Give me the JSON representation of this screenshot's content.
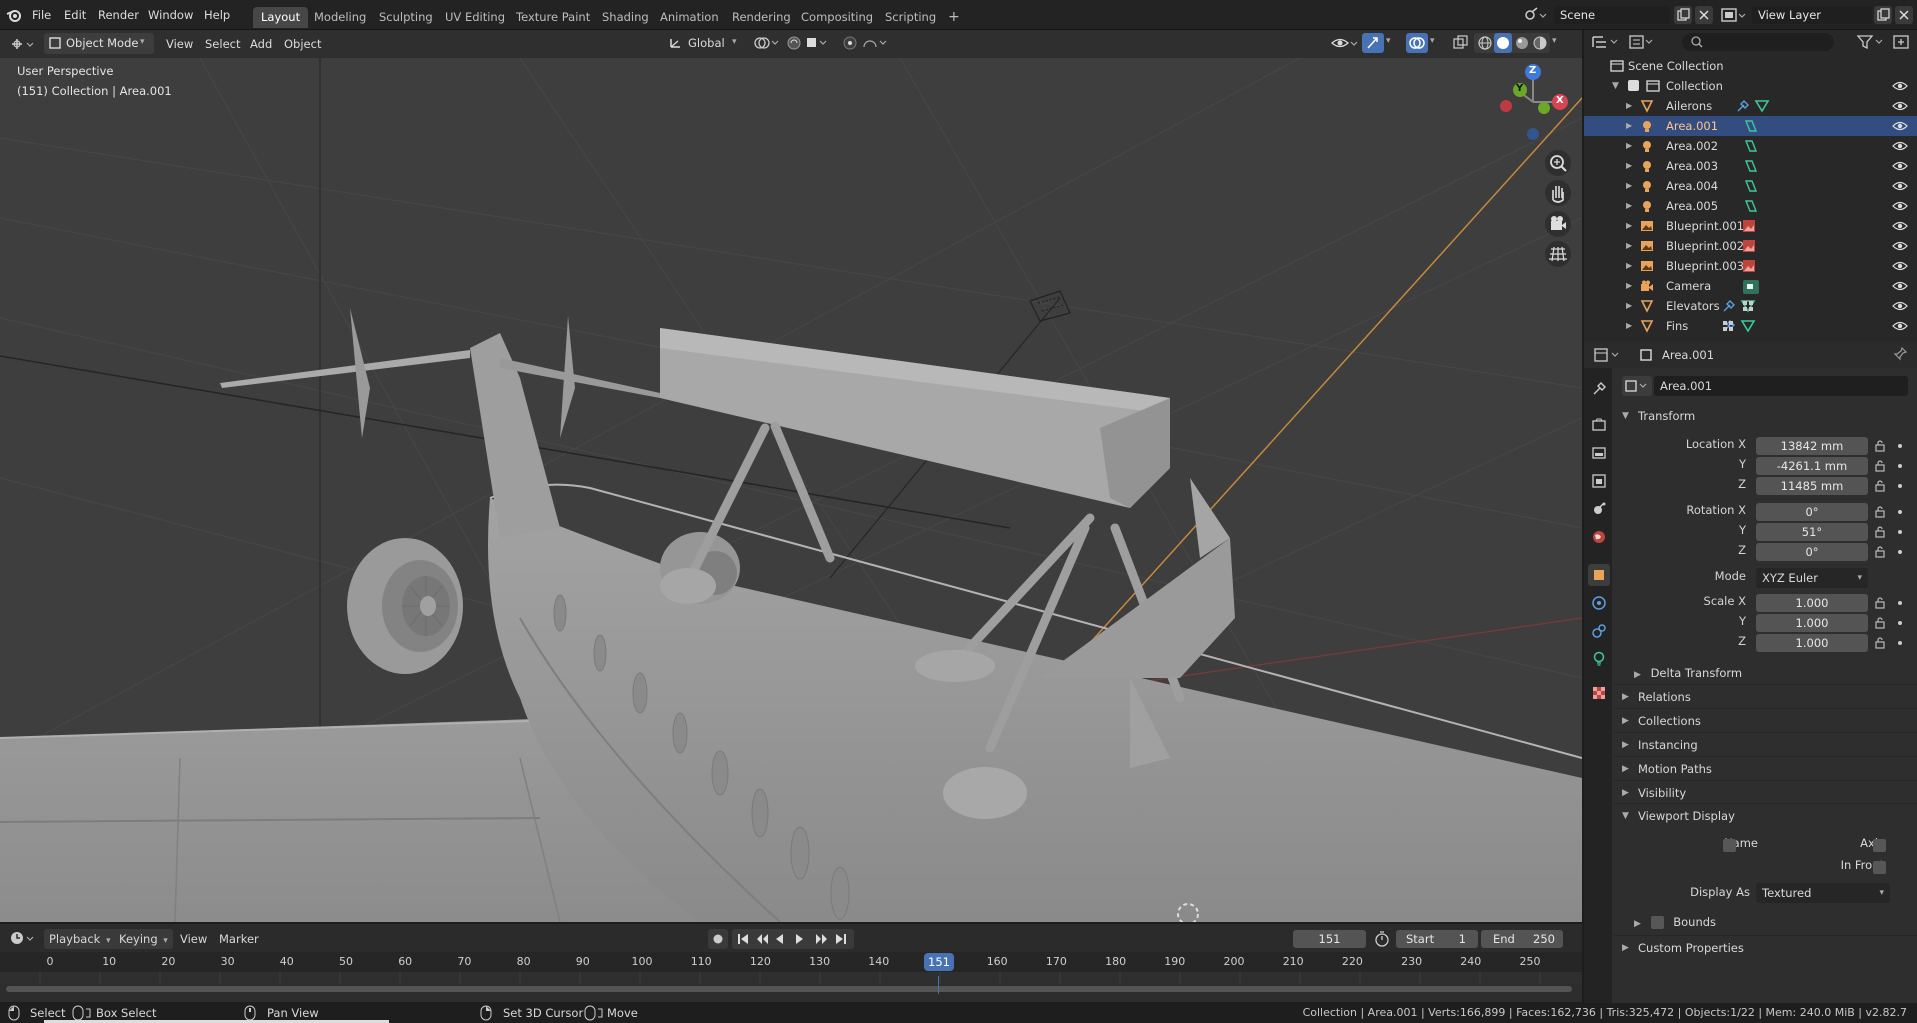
{
  "topbar": {
    "menus": [
      "File",
      "Edit",
      "Render",
      "Window",
      "Help"
    ],
    "workspaces": [
      "Layout",
      "Modeling",
      "Sculpting",
      "UV Editing",
      "Texture Paint",
      "Shading",
      "Animation",
      "Rendering",
      "Compositing",
      "Scripting"
    ],
    "add_tab": "+",
    "scene_name": "Scene",
    "view_layer": "View Layer"
  },
  "viewport_header": {
    "mode": "Object Mode",
    "menus": [
      "View",
      "Select",
      "Add",
      "Object"
    ],
    "transform_orientation": "Global"
  },
  "viewport": {
    "perspective_label": "User Perspective",
    "collection_label": "(151) Collection | Area.001",
    "gizmo": {
      "z": "Z",
      "y": "Y",
      "x": "X"
    }
  },
  "outliner": {
    "root": "Scene Collection",
    "collection": "Collection",
    "items": [
      {
        "name": "Ailerons",
        "kind": "mesh",
        "selected": false
      },
      {
        "name": "Area.001",
        "kind": "light",
        "selected": true
      },
      {
        "name": "Area.002",
        "kind": "light",
        "selected": false
      },
      {
        "name": "Area.003",
        "kind": "light",
        "selected": false
      },
      {
        "name": "Area.004",
        "kind": "light",
        "selected": false
      },
      {
        "name": "Area.005",
        "kind": "light",
        "selected": false
      },
      {
        "name": "Blueprint.001",
        "kind": "image",
        "selected": false
      },
      {
        "name": "Blueprint.002",
        "kind": "image",
        "selected": false
      },
      {
        "name": "Blueprint.003",
        "kind": "image",
        "selected": false
      },
      {
        "name": "Camera",
        "kind": "camera",
        "selected": false
      },
      {
        "name": "Elevators",
        "kind": "mesh",
        "selected": false
      },
      {
        "name": "Fins",
        "kind": "mesh",
        "selected": false
      }
    ]
  },
  "properties": {
    "header_object": "Area.001",
    "object_name": "Area.001",
    "transform_title": "Transform",
    "location": {
      "label_x": "Location X",
      "label_y": "Y",
      "label_z": "Z",
      "x": "13842 mm",
      "y": "-4261.1 mm",
      "z": "11485 mm"
    },
    "rotation": {
      "label_x": "Rotation X",
      "label_y": "Y",
      "label_z": "Z",
      "x": "0°",
      "y": "51°",
      "z": "0°"
    },
    "mode_label": "Mode",
    "mode_value": "XYZ Euler",
    "scale": {
      "label_x": "Scale X",
      "label_y": "Y",
      "label_z": "Z",
      "x": "1.000",
      "y": "1.000",
      "z": "1.000"
    },
    "delta_transform": "Delta Transform",
    "sections": [
      "Relations",
      "Collections",
      "Instancing",
      "Motion Paths",
      "Visibility"
    ],
    "viewport_display": "Viewport Display",
    "vd_name": "Name",
    "vd_axis": "Axis",
    "vd_infront": "In Front",
    "vd_display_as_label": "Display As",
    "vd_display_as": "Textured",
    "vd_bounds": "Bounds",
    "custom_properties": "Custom Properties"
  },
  "timeline": {
    "menus": [
      "Playback",
      "Keying",
      "View",
      "Marker"
    ],
    "current_frame": "151",
    "start_label": "Start",
    "start": "1",
    "end_label": "End",
    "end": "250",
    "ticks": [
      "0",
      "10",
      "20",
      "30",
      "40",
      "50",
      "60",
      "70",
      "80",
      "90",
      "100",
      "110",
      "120",
      "130",
      "140",
      "150",
      "160",
      "170",
      "180",
      "190",
      "200",
      "210",
      "220",
      "230",
      "240",
      "250"
    ],
    "playhead": "151"
  },
  "statusbar": {
    "select": "Select",
    "box_select": "Box Select",
    "pan_view": "Pan View",
    "set_cursor": "Set 3D Cursor",
    "move": "Move",
    "stats": "Collection | Area.001 | Verts:166,899 | Faces:162,736 | Tris:325,472 | Objects:1/22 | Mem: 240.0 MiB | v2.82.7"
  },
  "colors": {
    "selected_row": "#334d80",
    "active_frame": "#4772b3",
    "light_icon": "#e8a45b",
    "mesh_icon": "#e8a45b",
    "data_icon": "#3ec99a"
  }
}
